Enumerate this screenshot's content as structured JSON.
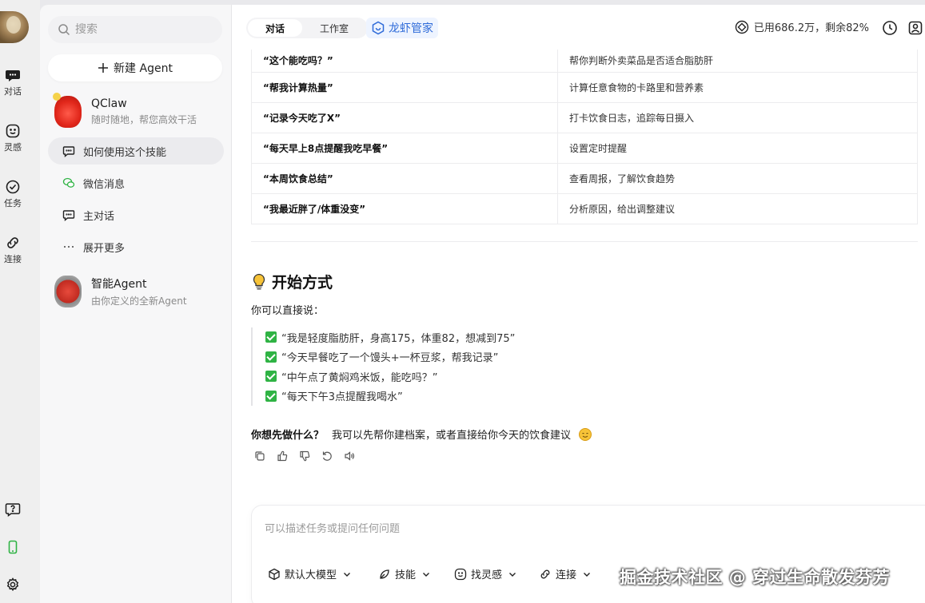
{
  "rail": {
    "items": [
      {
        "label": "对话"
      },
      {
        "label": "灵感"
      },
      {
        "label": "任务"
      },
      {
        "label": "连接"
      }
    ]
  },
  "sidebar": {
    "search_placeholder": "搜索",
    "new_agent_label": "新建 Agent",
    "qclaw": {
      "name": "QClaw",
      "subtitle": "随时随地，帮您高效干活"
    },
    "items": [
      {
        "label": "如何使用这个技能",
        "icon": "chat-bubble-icon"
      },
      {
        "label": "微信消息",
        "icon": "wechat-icon"
      },
      {
        "label": "主对话",
        "icon": "chat-bubble-icon"
      },
      {
        "label": "展开更多",
        "icon": "more-icon"
      }
    ],
    "smart_agent": {
      "name": "智能Agent",
      "subtitle": "由你定义的全新Agent"
    }
  },
  "topbar": {
    "tabs": [
      {
        "label": "对话"
      },
      {
        "label": "工作室"
      }
    ],
    "manager_label": "龙虾管家",
    "usage_text": "已用686.2万，剩余82%"
  },
  "skills_table": {
    "rows": [
      {
        "cmd": "“这个能吃吗？”",
        "desc": "帮你判断外卖菜品是否适合脂肪肝"
      },
      {
        "cmd": "“帮我计算热量”",
        "desc": "计算任意食物的卡路里和营养素"
      },
      {
        "cmd": "“记录今天吃了X”",
        "desc": "打卡饮食日志，追踪每日摄入"
      },
      {
        "cmd": "“每天早上8点提醒我吃早餐”",
        "desc": "设置定时提醒"
      },
      {
        "cmd": "“本周饮食总结”",
        "desc": "查看周报，了解饮食趋势"
      },
      {
        "cmd": "“我最近胖了/体重没变”",
        "desc": "分析原因，给出调整建议"
      }
    ]
  },
  "start": {
    "title": "开始方式",
    "intro": "你可以直接说：",
    "examples": [
      "“我是轻度脂肪肝，身高175，体重82，想减到75”",
      "“今天早餐吃了一个馒头+一杯豆浆，帮我记录”",
      "“中午点了黄焖鸡米饭，能吃吗？”",
      "“每天下午3点提醒我喝水”"
    ],
    "question_bold": "你想先做什么？",
    "question_rest": "我可以先帮你建档案，或者直接给你今天的饮食建议"
  },
  "composer": {
    "placeholder": "可以描述任务或提问任何问题",
    "tools": [
      {
        "label": "默认大模型"
      },
      {
        "label": "技能"
      },
      {
        "label": "找灵感"
      },
      {
        "label": "连接"
      }
    ],
    "watermark": "掘金技术社区 @ 穿过生命散发芬芳"
  },
  "colors": {
    "accent_blue": "#2f6bd9",
    "check_green": "#2fb344"
  }
}
